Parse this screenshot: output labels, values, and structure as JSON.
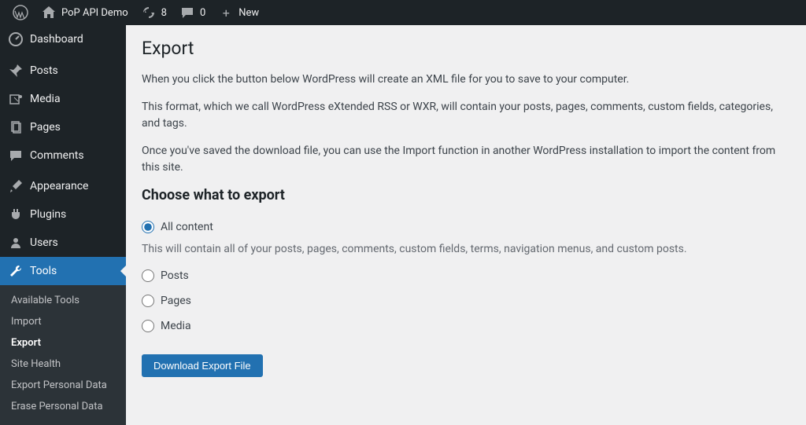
{
  "adminbar": {
    "site_name": "PoP API Demo",
    "updates_count": "8",
    "comments_count": "0",
    "new_label": "New"
  },
  "sidebar": {
    "items": [
      {
        "label": "Dashboard",
        "icon": "dashboard-icon"
      },
      {
        "label": "Posts",
        "icon": "pin-icon"
      },
      {
        "label": "Media",
        "icon": "media-icon"
      },
      {
        "label": "Pages",
        "icon": "pages-icon"
      },
      {
        "label": "Comments",
        "icon": "comments-icon"
      },
      {
        "label": "Appearance",
        "icon": "brush-icon"
      },
      {
        "label": "Plugins",
        "icon": "plug-icon"
      },
      {
        "label": "Users",
        "icon": "user-icon"
      },
      {
        "label": "Tools",
        "icon": "wrench-icon"
      }
    ],
    "submenu": [
      {
        "label": "Available Tools"
      },
      {
        "label": "Import"
      },
      {
        "label": "Export",
        "current": true
      },
      {
        "label": "Site Health"
      },
      {
        "label": "Export Personal Data"
      },
      {
        "label": "Erase Personal Data"
      }
    ]
  },
  "page": {
    "title": "Export",
    "p1": "When you click the button below WordPress will create an XML file for you to save to your computer.",
    "p2": "This format, which we call WordPress eXtended RSS or WXR, will contain your posts, pages, comments, custom fields, categories, and tags.",
    "p3": "Once you've saved the download file, you can use the Import function in another WordPress installation to import the content from this site.",
    "heading": "Choose what to export",
    "options": {
      "all": "All content",
      "all_desc": "This will contain all of your posts, pages, comments, custom fields, terms, navigation menus, and custom posts.",
      "posts": "Posts",
      "pages": "Pages",
      "media": "Media"
    },
    "submit_label": "Download Export File"
  }
}
